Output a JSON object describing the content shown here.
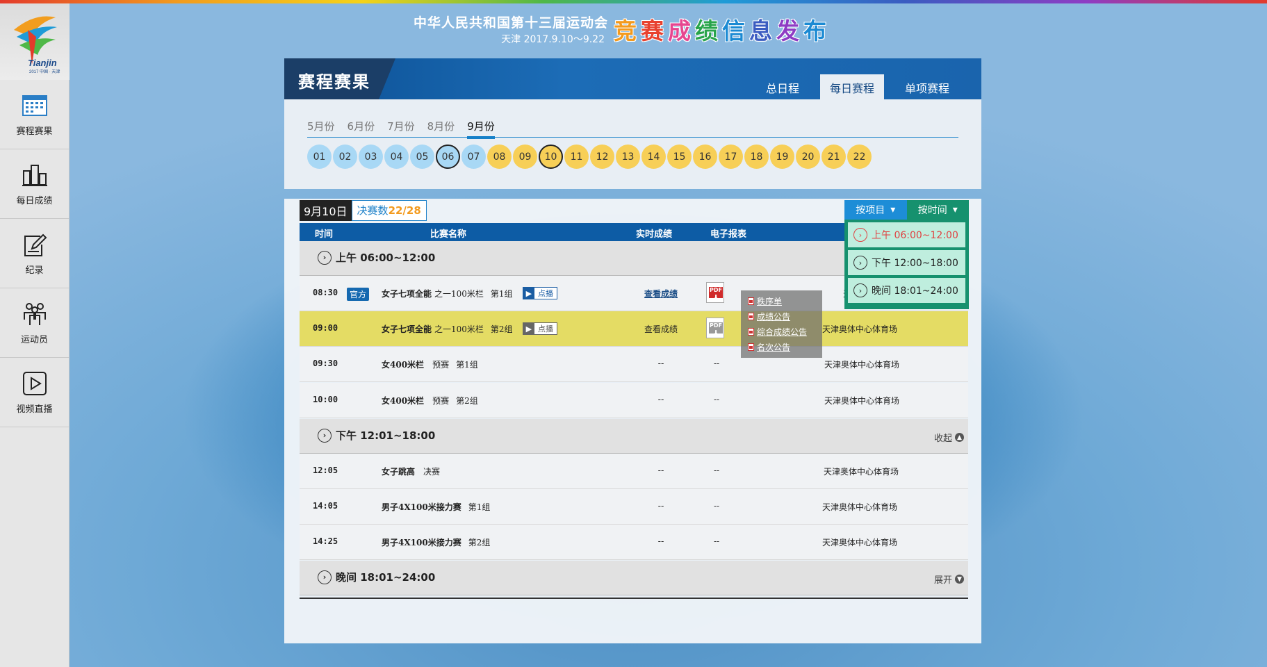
{
  "header": {
    "line1": "中华人民共和国第十三届运动会",
    "line2": "天津 2017.9.10～9.22",
    "big_title": [
      "竞",
      "赛",
      "成",
      "绩",
      "信",
      "息",
      "发",
      "布"
    ],
    "big_title_colors": [
      "#f39a1e",
      "#e8412f",
      "#e64690",
      "#28a44b",
      "#1b8ad3",
      "#3b5cc1",
      "#8e3cc4",
      "#1b8ad3"
    ]
  },
  "logo": {
    "text": "Tianjin",
    "sub": "2017 中国 · 天津"
  },
  "sidebar": {
    "items": [
      {
        "label": "赛程赛果",
        "icon": "calendar-icon"
      },
      {
        "label": "每日成绩",
        "icon": "daily-results-icon"
      },
      {
        "label": "纪录",
        "icon": "record-edit-icon"
      },
      {
        "label": "运动员",
        "icon": "athletes-icon"
      },
      {
        "label": "视频直播",
        "icon": "video-play-icon"
      }
    ]
  },
  "schedule": {
    "title": "赛程赛果",
    "tabs": [
      {
        "label": "总日程",
        "active": false
      },
      {
        "label": "每日赛程",
        "active": true
      },
      {
        "label": "单项赛程",
        "active": false
      }
    ],
    "months": [
      {
        "label": "5月份",
        "active": false
      },
      {
        "label": "6月份",
        "active": false
      },
      {
        "label": "7月份",
        "active": false
      },
      {
        "label": "8月份",
        "active": false
      },
      {
        "label": "9月份",
        "active": true
      }
    ],
    "days": [
      {
        "label": "01",
        "state": "past"
      },
      {
        "label": "02",
        "state": "past"
      },
      {
        "label": "03",
        "state": "past"
      },
      {
        "label": "04",
        "state": "past"
      },
      {
        "label": "05",
        "state": "past"
      },
      {
        "label": "06",
        "state": "past",
        "ring": true
      },
      {
        "label": "07",
        "state": "past"
      },
      {
        "label": "08",
        "state": "future"
      },
      {
        "label": "09",
        "state": "future"
      },
      {
        "label": "10",
        "state": "future",
        "ring": true
      },
      {
        "label": "11",
        "state": "future"
      },
      {
        "label": "12",
        "state": "future"
      },
      {
        "label": "13",
        "state": "future"
      },
      {
        "label": "14",
        "state": "future"
      },
      {
        "label": "15",
        "state": "future"
      },
      {
        "label": "16",
        "state": "future"
      },
      {
        "label": "17",
        "state": "future"
      },
      {
        "label": "18",
        "state": "future"
      },
      {
        "label": "19",
        "state": "future"
      },
      {
        "label": "20",
        "state": "future"
      },
      {
        "label": "21",
        "state": "future"
      },
      {
        "label": "22",
        "state": "future"
      }
    ]
  },
  "day_view": {
    "date": "9月10日",
    "finals_label": "决赛数",
    "finals_count": "22/28",
    "sort": {
      "by_event": "按项目",
      "by_time": "按时间",
      "options": [
        "上午 06:00~12:00",
        "下午 12:00~18:00",
        "晚间 18:01~24:00"
      ]
    },
    "columns": {
      "time": "时间",
      "name": "比赛名称",
      "live": "实时成绩",
      "report": "电子报表"
    },
    "groups": [
      {
        "label": "上午 06:00~12:00",
        "toggle": ""
      },
      {
        "label": "下午 12:01~18:00",
        "toggle": "收起"
      },
      {
        "label": "晚间 18:01~24:00",
        "toggle": "展开"
      }
    ],
    "rows": [
      {
        "time": "08:30",
        "official": "官方",
        "event": "女子七项全能",
        "detail": "之一100米栏",
        "group": "第1组",
        "vod": "点播",
        "result": "查看成绩",
        "venue": "天津奥体中心体育场"
      },
      {
        "time": "09:00",
        "official": "",
        "event": "女子七项全能",
        "detail": "之一100米栏",
        "group": "第2组",
        "vod": "点播",
        "result": "查看成绩",
        "venue": "天津奥体中心体育场"
      },
      {
        "time": "09:30",
        "event": "女400米栏",
        "detail": "预赛",
        "group": "第1组",
        "result": "--",
        "report": "--",
        "venue": "天津奥体中心体育场"
      },
      {
        "time": "10:00",
        "event": "女400米栏",
        "detail": "预赛",
        "group": "第2组",
        "result": "--",
        "report": "--",
        "venue": "天津奥体中心体育场"
      },
      {
        "time": "12:05",
        "event": "女子跳高",
        "detail": "决赛",
        "group": "",
        "result": "--",
        "report": "--",
        "venue": "天津奥体中心体育场"
      },
      {
        "time": "14:05",
        "event": "男子4X100米接力赛",
        "detail": "",
        "group": "第1组",
        "result": "--",
        "report": "--",
        "venue": "天津奥体中心体育场"
      },
      {
        "time": "14:25",
        "event": "男子4X100米接力赛",
        "detail": "",
        "group": "第2组",
        "result": "--",
        "report": "--",
        "venue": "天津奥体中心体育场"
      }
    ],
    "pdf_menu": [
      "秩序单",
      "成绩公告",
      "综合成绩公告",
      "名次公告"
    ],
    "partial_venue": "天津"
  }
}
